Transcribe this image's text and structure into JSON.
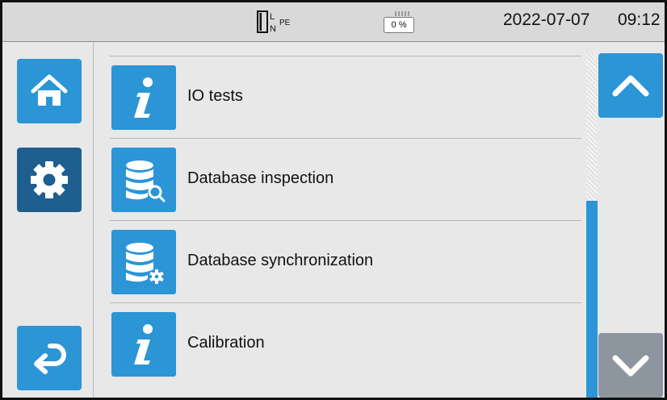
{
  "statusbar": {
    "date": "2022-07-07",
    "time": "09:12",
    "battery_percent_label": "0 %",
    "plug": {
      "l": "L",
      "n": "N",
      "pe": "PE"
    }
  },
  "nav": {
    "home_icon": "home-icon",
    "settings_icon": "gear-icon",
    "back_icon": "return-arrow-icon",
    "scroll_up_icon": "chevron-up-icon",
    "scroll_down_icon": "chevron-down-icon"
  },
  "menu": {
    "items": [
      {
        "label": "IO tests",
        "icon": "info-icon"
      },
      {
        "label": "Database inspection",
        "icon": "database-search-icon"
      },
      {
        "label": "Database synchronization",
        "icon": "database-settings-icon"
      },
      {
        "label": "Calibration",
        "icon": "info-icon"
      }
    ]
  },
  "colors": {
    "accent": "#2b95d6",
    "selected": "#1f5f8f",
    "disabled": "#8d969f"
  }
}
